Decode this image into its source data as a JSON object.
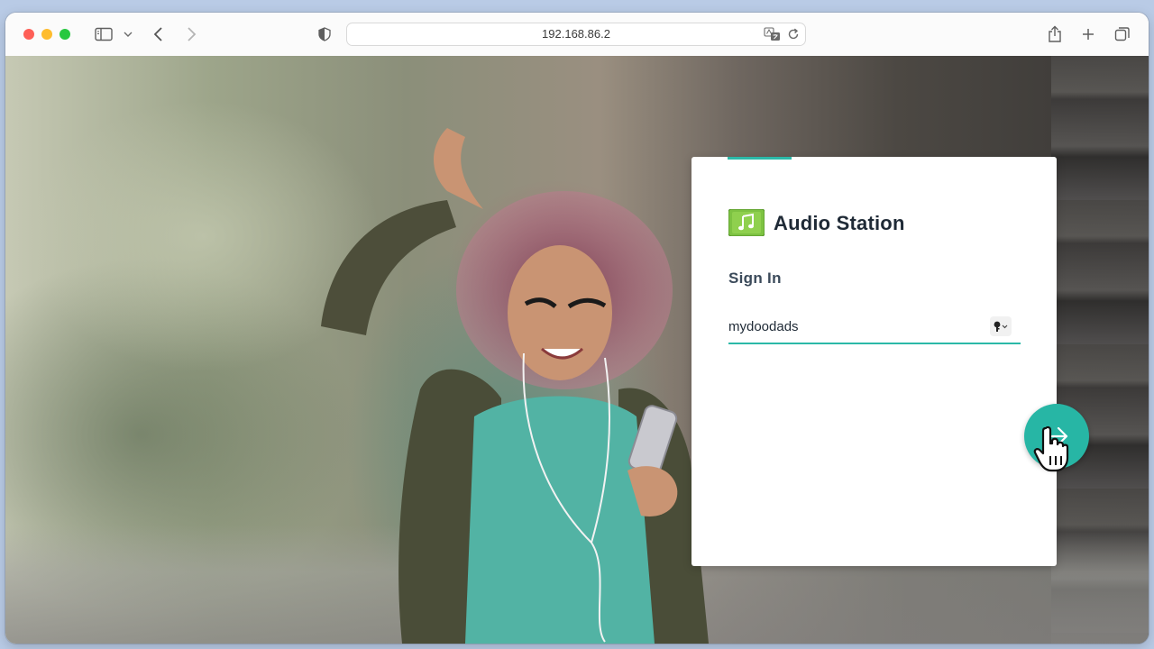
{
  "browser": {
    "address": "192.168.86.2",
    "toolbar_icons": [
      "sidebar-icon",
      "chevron-down-icon",
      "back-icon",
      "forward-icon",
      "shield-icon",
      "translate-icon",
      "reload-icon",
      "share-icon",
      "plus-icon",
      "tabs-icon"
    ]
  },
  "login": {
    "app_name": "Audio Station",
    "heading": "Sign In",
    "username_value": "mydoodads",
    "icons": {
      "app": "audio-station-music-note-icon",
      "autofill": "key-icon",
      "next": "arrow-right-icon",
      "cursor": "hand-pointer-cursor"
    }
  },
  "colors": {
    "accent": "#2bb9a8",
    "next_button": "#27b6a5",
    "app_icon_green": "#7dc242",
    "title_text": "#1f2a36"
  }
}
